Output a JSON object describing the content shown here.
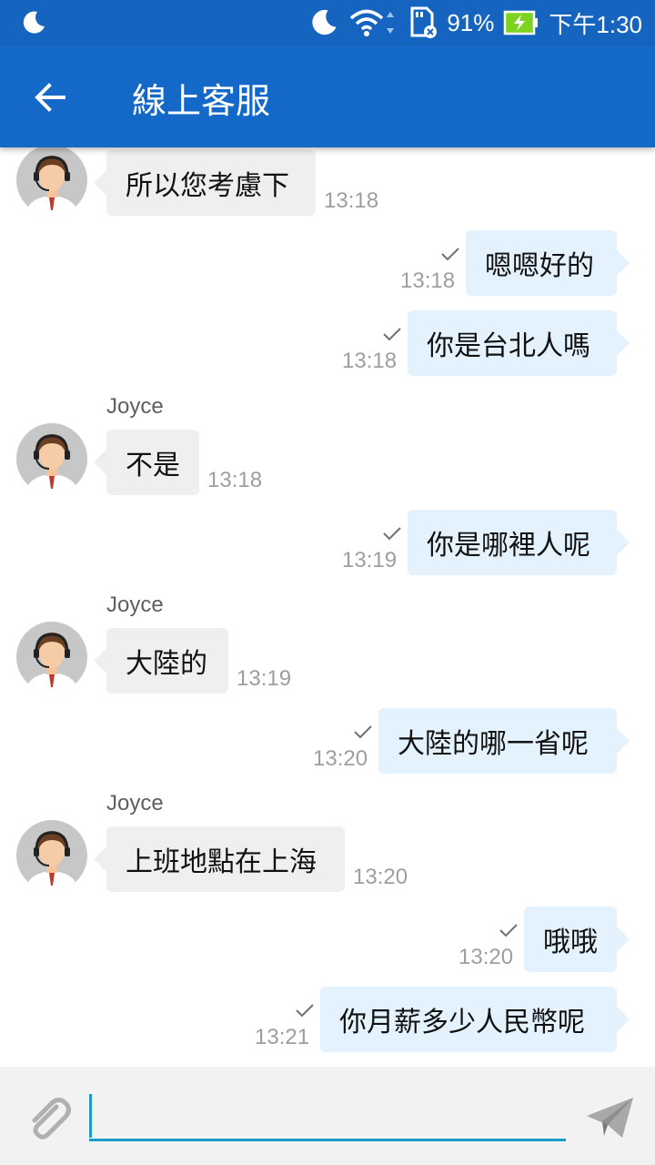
{
  "status_bar": {
    "battery": "91%",
    "time": "下午1:30",
    "icons": [
      "moon-icon",
      "wifi-icon",
      "sd-card-icon",
      "battery-charging-icon"
    ]
  },
  "app_bar": {
    "title": "線上客服",
    "back_icon": "arrow-left-icon"
  },
  "colors": {
    "app_bar": "#1469c8",
    "incoming_bubble": "#efefef",
    "outgoing_bubble": "#e3f2fd",
    "input_underline": "#1a9bc9"
  },
  "messages": [
    {
      "side": "in",
      "sender": "",
      "text": "所以您考慮下",
      "time": "13:18"
    },
    {
      "side": "out",
      "text": "嗯嗯好的",
      "time": "13:18",
      "read": true
    },
    {
      "side": "out",
      "text": "你是台北人嗎",
      "time": "13:18",
      "read": true
    },
    {
      "side": "in",
      "sender": "Joyce",
      "text": "不是",
      "time": "13:18"
    },
    {
      "side": "out",
      "text": "你是哪裡人呢",
      "time": "13:19",
      "read": true
    },
    {
      "side": "in",
      "sender": "Joyce",
      "text": "大陸的",
      "time": "13:19"
    },
    {
      "side": "out",
      "text": "大陸的哪一省呢",
      "time": "13:20",
      "read": true
    },
    {
      "side": "in",
      "sender": "Joyce",
      "text": "上班地點在上海",
      "time": "13:20"
    },
    {
      "side": "out",
      "text": "哦哦",
      "time": "13:20",
      "read": true
    },
    {
      "side": "out",
      "text": "你月薪多少人民幣呢",
      "time": "13:21",
      "read": true
    }
  ],
  "input_bar": {
    "value": "",
    "placeholder": "",
    "attach_icon": "paperclip-icon",
    "send_icon": "send-icon"
  }
}
